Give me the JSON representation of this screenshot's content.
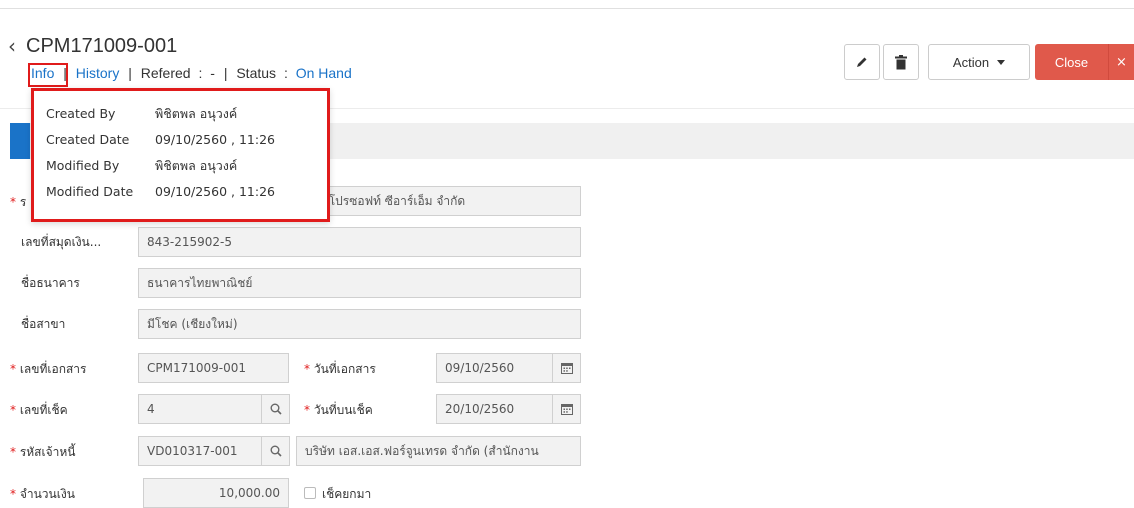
{
  "header": {
    "back_icon": "chevron-left-icon",
    "doc_number": "CPM171009-001",
    "subnav": {
      "info": "Info",
      "history": "History",
      "refered_label": "Refered",
      "refered_value": "-",
      "status_label": "Status",
      "status_value": "On Hand",
      "colon": ":",
      "bar": "|"
    },
    "toolbar": {
      "edit_icon": "pencil-icon",
      "delete_icon": "trash-icon",
      "action_label": "Action",
      "close_label": "Close",
      "close_x": "×"
    }
  },
  "info_popup": {
    "rows": [
      {
        "key": "Created By",
        "value": "พิชิตพล อนุวงค์"
      },
      {
        "key": "Created Date",
        "value": "09/10/2560 , 11:26"
      },
      {
        "key": "Modified By",
        "value": "พิชิตพล อนุวงค์"
      },
      {
        "key": "Modified Date",
        "value": "09/10/2560 , 11:26"
      }
    ]
  },
  "form": {
    "company_partial_label": "ร",
    "company_value": "ท โปรซอฟท์ ซีอาร์เอ็ม จำกัด",
    "account_no_label": "เลขที่สมุดเงิน...",
    "account_no_value": "843-215902-5",
    "bank_label": "ชื่อธนาคาร",
    "bank_value": "ธนาคารไทยพาณิชย์",
    "branch_label": "ชื่อสาขา",
    "branch_value": "มีโชค (เชียงใหม่)",
    "doc_no_label": "เลขที่เอกสาร",
    "doc_no_value": "CPM171009-001",
    "doc_date_label": "วันที่เอกสาร",
    "doc_date_value": "09/10/2560",
    "cheque_no_label": "เลขที่เช็ค",
    "cheque_no_value": "4",
    "cheque_date_label": "วันที่บนเช็ค",
    "cheque_date_value": "20/10/2560",
    "creditor_code_label": "รหัสเจ้าหนี้",
    "creditor_code_value": "VD010317-001",
    "creditor_name_value": "บริษัท เอส.เอส.ฟอร์จูนเทรด จำกัด (สำนักงาน",
    "amount_label": "จำนวนเงิน",
    "amount_value": "10,000.00",
    "carry_cheque_label": "เช็คยกมา",
    "required_mark": "*"
  }
}
